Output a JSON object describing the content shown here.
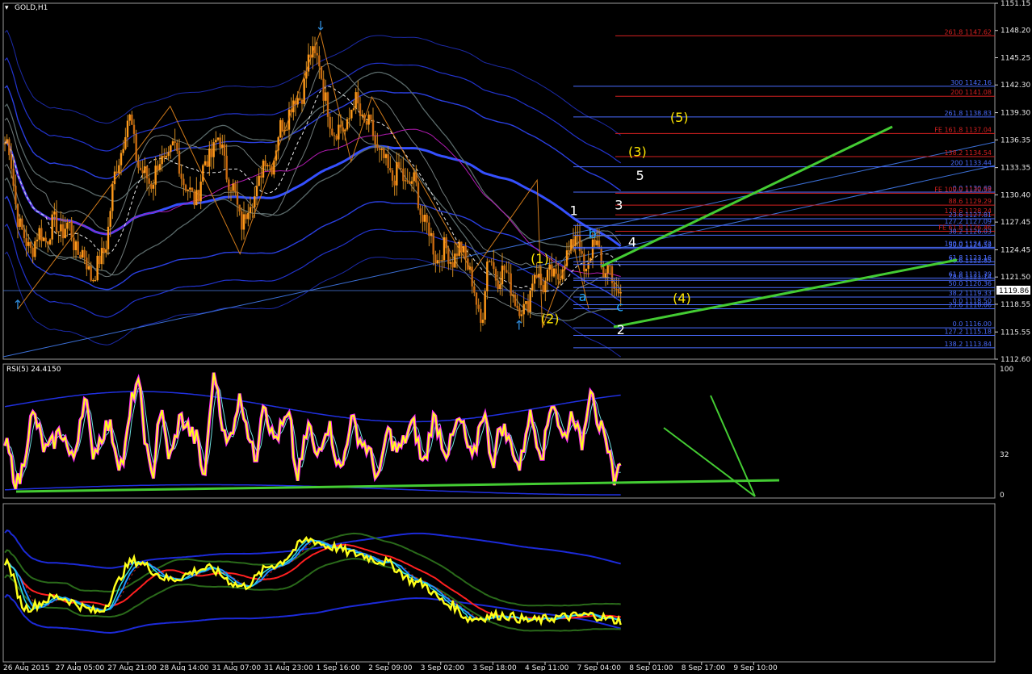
{
  "window": {
    "title": "GOLD,H1",
    "current_price": "1119.86"
  },
  "price_panel": {
    "scale": [
      1151.15,
      1148.2,
      1145.25,
      1142.3,
      1139.3,
      1136.35,
      1133.35,
      1130.4,
      1127.45,
      1124.45,
      1121.5,
      1118.55,
      1115.55,
      1112.6
    ],
    "ylim": [
      1112.6,
      1151.15
    ],
    "fib_levels": [
      {
        "label": "261.8  1147.62",
        "value": 1147.62,
        "color": "#d42020"
      },
      {
        "label": "300  1142.16",
        "value": 1142.16,
        "color": "#4a6cff"
      },
      {
        "label": "200  1141.08",
        "value": 1141.08,
        "color": "#d42020"
      },
      {
        "label": "261.8  1138.83",
        "value": 1138.83,
        "color": "#4a6cff"
      },
      {
        "label": "FE 161.8  1137.04",
        "value": 1137.04,
        "color": "#d42020"
      },
      {
        "label": "138.2  1134.54",
        "value": 1134.54,
        "color": "#d42020"
      },
      {
        "label": "200  1133.44",
        "value": 1133.44,
        "color": "#4a6cff"
      },
      {
        "label": "0.0  1130.69",
        "value": 1130.69,
        "color": "#4a6cff"
      },
      {
        "label": "FE 100.0  1130.58",
        "value": 1130.58,
        "color": "#d42020"
      },
      {
        "label": "88.6  1129.29",
        "value": 1129.29,
        "color": "#d42020"
      },
      {
        "label": "178.6  1128.24",
        "value": 1128.24,
        "color": "#d42020"
      },
      {
        "label": "23.6  1127.81",
        "value": 1127.81,
        "color": "#4a6cff"
      },
      {
        "label": "127.2  1127.09",
        "value": 1127.09,
        "color": "#4a6cff"
      },
      {
        "label": "FE 61.8  1126.46",
        "value": 1126.46,
        "color": "#d42020"
      },
      {
        "label": "38.2  1126.03",
        "value": 1126.03,
        "color": "#4a6cff"
      },
      {
        "label": "100.0  1124.72",
        "value": 1124.72,
        "color": "#4a6cff"
      },
      {
        "label": "50.0  1124.59",
        "value": 1124.59,
        "color": "#4a6cff"
      },
      {
        "label": "61.8  1123.16",
        "value": 1123.16,
        "color": "#4a6cff"
      },
      {
        "label": "78.6  1122.85",
        "value": 1122.85,
        "color": "#4a6cff"
      },
      {
        "label": "61.8  1121.39",
        "value": 1121.39,
        "color": "#4a6cff"
      },
      {
        "label": "78.6  1121.14",
        "value": 1121.14,
        "color": "#4a6cff"
      },
      {
        "label": "50.0  1120.36",
        "value": 1120.36,
        "color": "#4a6cff"
      },
      {
        "label": "38.2  1119.33",
        "value": 1119.33,
        "color": "#4a6cff"
      },
      {
        "label": "0.0  1118.50",
        "value": 1118.5,
        "color": "#4a6cff"
      },
      {
        "label": "23.6  1118.06",
        "value": 1118.06,
        "color": "#4a6cff"
      },
      {
        "label": "0.0  1116.00",
        "value": 1116.0,
        "color": "#4a6cff"
      },
      {
        "label": "127.2  1115.18",
        "value": 1115.18,
        "color": "#4a6cff"
      },
      {
        "label": "138.2  1113.84",
        "value": 1113.84,
        "color": "#4a6cff"
      }
    ],
    "wave_labels": [
      {
        "text": "(5)",
        "color": "#ffe600",
        "x_day": 13.05,
        "price": 1138.3
      },
      {
        "text": "(3)",
        "color": "#ffe600",
        "x_day": 12.24,
        "price": 1134.6
      },
      {
        "text": "5",
        "color": "#ffffff",
        "x_day": 12.29,
        "price": 1132.0
      },
      {
        "text": "3",
        "color": "#ffffff",
        "x_day": 11.88,
        "price": 1128.8
      },
      {
        "text": "1",
        "color": "#ffffff",
        "x_day": 11.01,
        "price": 1128.2
      },
      {
        "text": "b",
        "color": "#22a8ff",
        "x_day": 11.37,
        "price": 1125.7
      },
      {
        "text": "4",
        "color": "#ffffff",
        "x_day": 12.14,
        "price": 1124.8
      },
      {
        "text": "(1)",
        "color": "#ffe600",
        "x_day": 10.35,
        "price": 1123.0
      },
      {
        "text": "a",
        "color": "#22a8ff",
        "x_day": 11.18,
        "price": 1118.9
      },
      {
        "text": "(4)",
        "color": "#ffe600",
        "x_day": 13.1,
        "price": 1118.7
      },
      {
        "text": "c",
        "color": "#22a8ff",
        "x_day": 11.9,
        "price": 1117.8
      },
      {
        "text": "(2)",
        "color": "#ffe600",
        "x_day": 10.55,
        "price": 1116.5
      },
      {
        "text": "2",
        "color": "#ffffff",
        "x_day": 11.92,
        "price": 1115.3
      }
    ],
    "fractal_arrows": [
      {
        "dir": "down",
        "x_day": 6.11,
        "price": 1148.2
      },
      {
        "dir": "up",
        "x_day": 0.25,
        "price": 1118.0
      },
      {
        "dir": "up",
        "x_day": 9.95,
        "price": 1115.8
      }
    ]
  },
  "rsi_panel": {
    "label": "RSI(5) 24.4150",
    "scale": [
      "100",
      "32",
      "0"
    ]
  },
  "x_axis": {
    "labels": [
      "26 Aug 2015",
      "27 Aug 05:00",
      "27 Aug 21:00",
      "28 Aug 14:00",
      "31 Aug 07:00",
      "31 Aug 23:00",
      "1 Sep 16:00",
      "2 Sep 09:00",
      "3 Sep 02:00",
      "3 Sep 18:00",
      "4 Sep 11:00",
      "7 Sep 04:00",
      "8 Sep 01:00",
      "8 Sep 17:00",
      "9 Sep 10:00"
    ]
  },
  "chart_data": {
    "type": "candlestick",
    "symbol": "GOLD",
    "timeframe": "H1",
    "ylim": [
      1112.6,
      1151.15
    ],
    "anchors_x_day": [
      0,
      0.4,
      1.1,
      1.75,
      2.4,
      2.7,
      3.3,
      3.6,
      4.1,
      4.6,
      5.1,
      5.55,
      6.05,
      6.2,
      6.45,
      6.8,
      7.1,
      7.4,
      7.8,
      8.4,
      8.9,
      9.2,
      9.35,
      9.55,
      9.8,
      9.95,
      10.3,
      10.5,
      10.8,
      11.05,
      11.2,
      11.4,
      11.6,
      11.9
    ],
    "anchors_close": [
      1136,
      1125,
      1127,
      1122,
      1138,
      1132,
      1135,
      1130,
      1136,
      1128,
      1134,
      1140,
      1146,
      1140,
      1137,
      1140,
      1137,
      1133,
      1132,
      1124,
      1124,
      1117,
      1123,
      1122,
      1121,
      1117.5,
      1121.5,
      1121,
      1122.5,
      1126.5,
      1122,
      1125,
      1122.5,
      1119.86
    ],
    "rsi_anchors_x_day": [
      0,
      0.25,
      0.55,
      0.8,
      1.1,
      1.3,
      1.55,
      1.7,
      2.0,
      2.25,
      2.55,
      2.85,
      3.0,
      3.2,
      3.4,
      3.7,
      3.85,
      4.05,
      4.3,
      4.55,
      4.85,
      5.0,
      5.2,
      5.5,
      5.65,
      5.9,
      6.0,
      6.25,
      6.5,
      6.7,
      6.95,
      7.25,
      7.4,
      7.6,
      7.9,
      8.1,
      8.3,
      8.55,
      8.8,
      9.05,
      9.25,
      9.45,
      9.6,
      9.8,
      9.95,
      10.15,
      10.4,
      10.6,
      10.8,
      11.0,
      11.15,
      11.35,
      11.5,
      11.7,
      11.8,
      11.95
    ],
    "rsi_anchors_value": [
      40,
      10,
      62,
      35,
      50,
      28,
      75,
      35,
      55,
      25,
      88,
      15,
      65,
      30,
      60,
      45,
      15,
      95,
      40,
      75,
      30,
      75,
      45,
      60,
      15,
      55,
      30,
      55,
      20,
      58,
      40,
      15,
      50,
      35,
      55,
      25,
      60,
      35,
      58,
      28,
      65,
      28,
      55,
      40,
      22,
      62,
      35,
      75,
      45,
      65,
      40,
      88,
      55,
      28,
      15,
      22
    ],
    "lower_anchors_x_day": [
      0,
      0.4,
      1.0,
      1.8,
      2.5,
      3.2,
      3.9,
      4.6,
      5.2,
      5.9,
      6.3,
      6.8,
      7.3,
      8.0,
      8.6,
      9.0,
      9.6,
      10.2,
      10.8,
      11.3,
      11.9
    ],
    "lower_anchors_close": [
      1136,
      1123,
      1126,
      1122,
      1136,
      1131,
      1134,
      1129,
      1135,
      1142,
      1140,
      1138,
      1136,
      1130,
      1124,
      1120,
      1121,
      1119.5,
      1120.5,
      1121,
      1119.5
    ],
    "trendlines": "green Elliott wave channel, wave (4) support"
  }
}
